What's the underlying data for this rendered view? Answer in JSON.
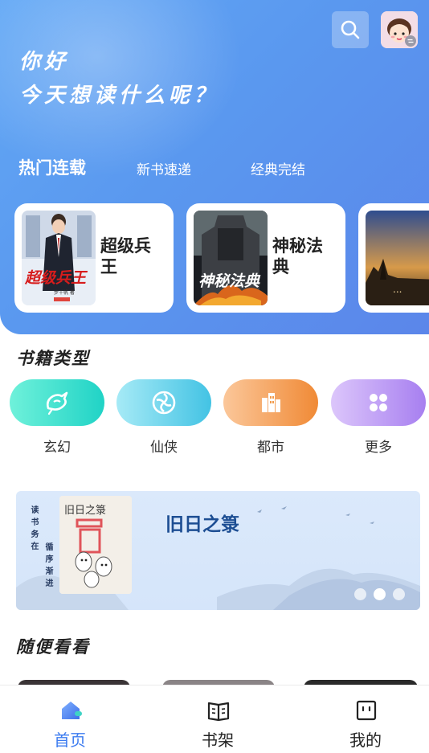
{
  "header": {
    "greeting": "你好",
    "prompt": "今天想读什么呢？",
    "search_icon": "search-icon",
    "avatar_icon": "avatar"
  },
  "tabs": [
    {
      "label": "热门连载",
      "active": true
    },
    {
      "label": "新书速递",
      "active": false
    },
    {
      "label": "经典完结",
      "active": false
    }
  ],
  "featured_books": [
    {
      "title": "超级兵王",
      "cover_text": "超级兵王",
      "cover_author": "步千帆 著"
    },
    {
      "title": "神秘法典",
      "cover_text": "神秘法典"
    },
    {
      "title": "",
      "cover_text": "..."
    }
  ],
  "categories": {
    "title": "书籍类型",
    "items": [
      {
        "label": "玄幻",
        "icon": "dragon-icon",
        "color": "#2fd8c9"
      },
      {
        "label": "仙侠",
        "icon": "swirl-icon",
        "color": "#47c7e6"
      },
      {
        "label": "都市",
        "icon": "buildings-icon",
        "color": "#f29a49"
      },
      {
        "label": "更多",
        "icon": "grid-icon",
        "color": "#b088f2"
      }
    ]
  },
  "banner": {
    "title": "旧日之箓",
    "cover_text": "旧日之箓",
    "side_left": "读书务在",
    "side_right": "循序渐进",
    "active_dot": 1
  },
  "random_section": {
    "title": "随便看看"
  },
  "bottom_nav": [
    {
      "label": "首页",
      "icon": "home-icon",
      "active": true
    },
    {
      "label": "书架",
      "icon": "bookshelf-icon",
      "active": false
    },
    {
      "label": "我的",
      "icon": "profile-icon",
      "active": false
    }
  ],
  "colors": {
    "accent": "#3d7cf0",
    "hero": "#5a98ef"
  }
}
